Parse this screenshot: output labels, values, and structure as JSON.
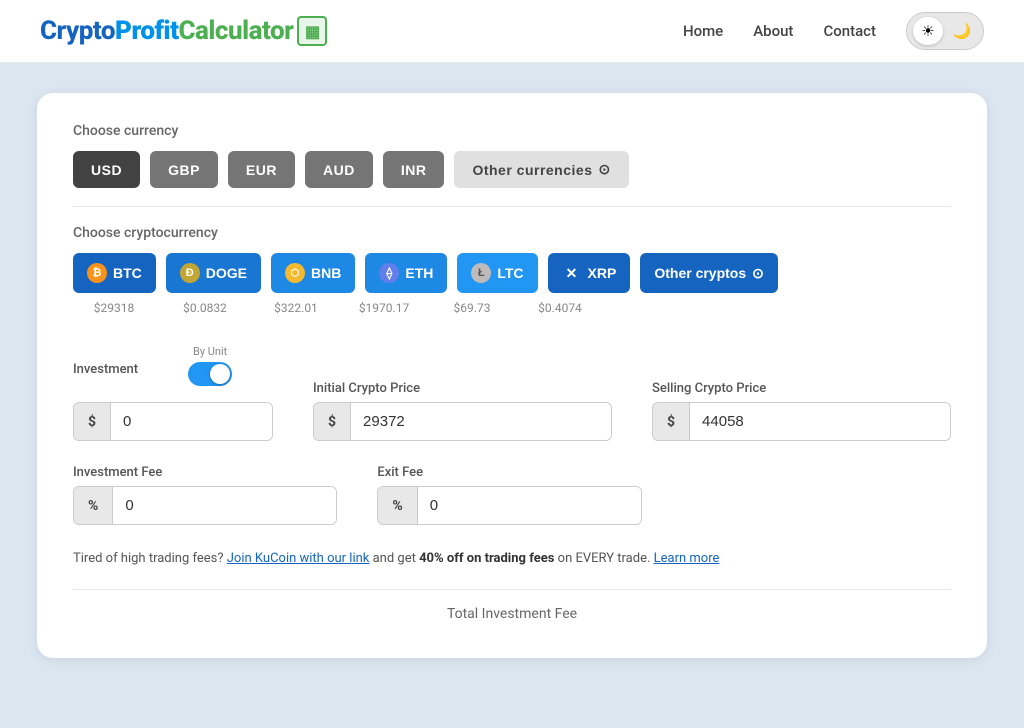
{
  "logo": {
    "crypto": "Crypt",
    "o_symbol": "ο",
    "profit": "Profit",
    "calculator": "Calculator",
    "icon": "▦"
  },
  "nav": {
    "home": "Home",
    "about": "About",
    "contact": "Contact",
    "theme_light": "☀",
    "theme_dark": "🌙"
  },
  "currency": {
    "label": "Choose currency",
    "buttons": [
      "USD",
      "GBP",
      "EUR",
      "AUD",
      "INR"
    ],
    "other_label": "Other currencies",
    "other_icon": "⌄"
  },
  "crypto": {
    "label": "Choose cryptocurrency",
    "coins": [
      {
        "id": "btc",
        "label": "BTC",
        "icon": "₿",
        "icon_class": "icon-btc",
        "price": "$29318"
      },
      {
        "id": "doge",
        "label": "DOGE",
        "icon": "Ð",
        "icon_class": "icon-doge",
        "price": "$0.0832"
      },
      {
        "id": "bnb",
        "label": "BNB",
        "icon": "⬡",
        "icon_class": "icon-bnb",
        "price": "$322.01"
      },
      {
        "id": "eth",
        "label": "ETH",
        "icon": "⟠",
        "icon_class": "icon-eth",
        "price": "$1970.17"
      },
      {
        "id": "ltc",
        "label": "LTC",
        "icon": "Ł",
        "icon_class": "icon-ltc",
        "price": "$69.73"
      },
      {
        "id": "xrp",
        "label": "XRP",
        "icon": "✕",
        "icon_class": "icon-xrp",
        "price": "$0.4074"
      }
    ],
    "other_label": "Other cryptos",
    "other_icon": "⌄"
  },
  "form": {
    "investment_label": "Investment",
    "investment_value": "0",
    "investment_prefix": "$",
    "by_unit_label": "By Unit",
    "initial_price_label": "Initial Crypto Price",
    "initial_price_value": "29372",
    "initial_price_prefix": "$",
    "selling_price_label": "Selling Crypto Price",
    "selling_price_value": "44058",
    "selling_price_prefix": "$",
    "investment_fee_label": "Investment Fee",
    "investment_fee_value": "0",
    "investment_fee_prefix": "%",
    "exit_fee_label": "Exit Fee",
    "exit_fee_value": "0",
    "exit_fee_prefix": "%"
  },
  "promo": {
    "text_before": "Tired of high trading fees?",
    "link_text": "Join KuCoin with our link",
    "text_middle": "and get",
    "bold_text": "40% off on trading fees",
    "text_after": "on EVERY trade.",
    "learn_more": "Learn more"
  },
  "total": {
    "label": "Total Investment Fee"
  }
}
